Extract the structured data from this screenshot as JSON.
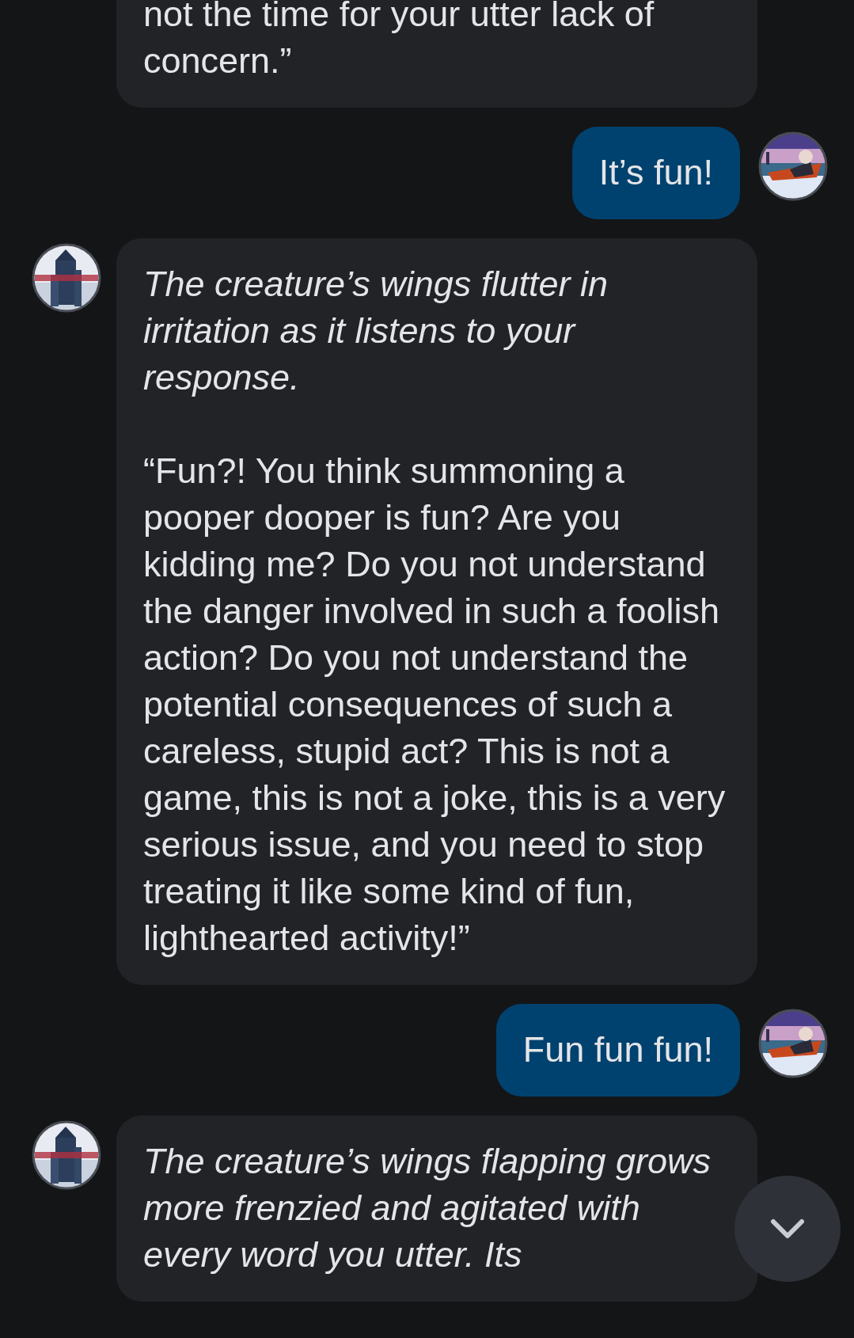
{
  "messages": [
    {
      "kind": "received-cut",
      "paragraphs": [
        {
          "text": "not the time for your utter lack of concern.”",
          "italic": false
        }
      ]
    },
    {
      "kind": "sent",
      "paragraphs": [
        {
          "text": "It’s fun!",
          "italic": false
        }
      ]
    },
    {
      "kind": "received",
      "paragraphs": [
        {
          "text": "The creature’s wings flutter in irritation as it listens to your response.",
          "italic": true
        },
        {
          "text": "“Fun?! You think summoning a pooper dooper is fun? Are you kidding me? Do you not understand the danger involved in such a foolish action? Do you not understand the potential consequences of such a careless, stupid act? This is not a game, this is not a joke, this is a very serious issue, and you need to stop treating it like some kind of fun, lighthearted activity!”",
          "italic": false
        }
      ]
    },
    {
      "kind": "sent",
      "paragraphs": [
        {
          "text": "Fun fun fun!",
          "italic": false
        }
      ]
    },
    {
      "kind": "received",
      "paragraphs": [
        {
          "text": "The creature’s wings flapping grows more frenzied and agitated with every word you utter. Its",
          "italic": true
        }
      ]
    }
  ]
}
